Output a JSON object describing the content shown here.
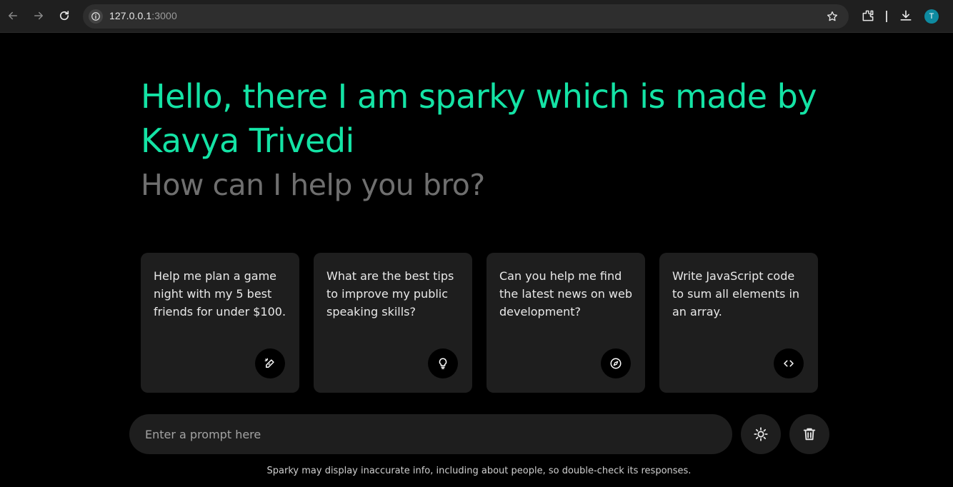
{
  "browser": {
    "url_host": "127.0.0.1",
    "url_port": ":3000",
    "avatar_letter": "T",
    "icons": [
      "back-icon",
      "forward-icon",
      "reload-icon",
      "site-info-icon",
      "bookmark-star-icon",
      "extensions-icon",
      "downloads-icon"
    ]
  },
  "greeting": {
    "line1": "Hello, there I am sparky which is made by Kavya Trivedi",
    "line2": "How can I help you bro?",
    "accent_color": "#14e3a5"
  },
  "cards": [
    {
      "text": "Help me plan a game night with my 5 best friends for under $100.",
      "icon": "pen-sparkle-icon"
    },
    {
      "text": "What are the best tips to improve my public speaking skills?",
      "icon": "lightbulb-icon"
    },
    {
      "text": "Can you help me find the latest news on web development?",
      "icon": "compass-icon"
    },
    {
      "text": "Write JavaScript code to sum all elements in an array.",
      "icon": "code-icon"
    }
  ],
  "prompt": {
    "placeholder": "Enter a prompt here",
    "value": ""
  },
  "actions": {
    "theme_icon": "sun-icon",
    "delete_icon": "trash-icon"
  },
  "disclaimer": "Sparky may display inaccurate info, including about people, so double-check its responses."
}
